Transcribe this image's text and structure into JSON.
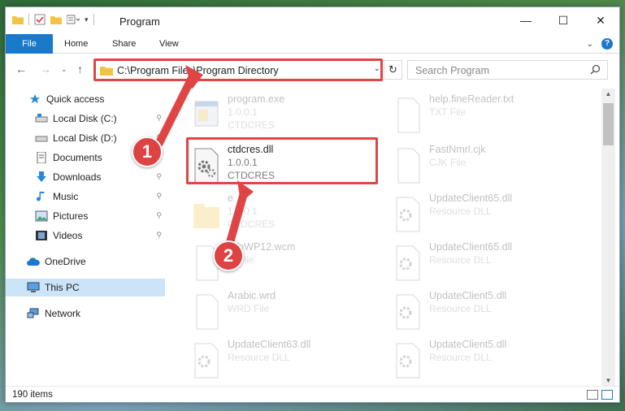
{
  "window": {
    "title": "Program"
  },
  "ribbon": {
    "tabs": [
      "File",
      "Home",
      "Share",
      "View"
    ]
  },
  "address": {
    "path": "C:\\Program Files\\Program Directory"
  },
  "search": {
    "placeholder": "Search Program"
  },
  "sidebar": {
    "items": [
      {
        "label": "Quick access",
        "icon": "star-icon"
      },
      {
        "label": "Local Disk (C:)",
        "icon": "drive-icon"
      },
      {
        "label": "Local Disk (D:)",
        "icon": "drive-icon"
      },
      {
        "label": "Documents",
        "icon": "documents-icon"
      },
      {
        "label": "Downloads",
        "icon": "download-icon"
      },
      {
        "label": "Music",
        "icon": "music-icon"
      },
      {
        "label": "Pictures",
        "icon": "pictures-icon"
      },
      {
        "label": "Videos",
        "icon": "video-icon"
      },
      {
        "label": "OneDrive",
        "icon": "cloud-icon"
      },
      {
        "label": "This PC",
        "icon": "computer-icon"
      },
      {
        "label": "Network",
        "icon": "network-icon"
      }
    ]
  },
  "files": [
    {
      "name": "program.exe",
      "line1": "1.0.0.1",
      "line2": "CTDCRES"
    },
    {
      "name": "help.fineReader.txt",
      "line1": "TXT File",
      "line2": ""
    },
    {
      "name": "ctdcres.dll",
      "line1": "1.0.0.1",
      "line2": "CTDCRES"
    },
    {
      "name": "FastNmrl.cjk",
      "line1": "CJK File",
      "line2": ""
    },
    {
      "name": "e",
      "line1": "1.0.0.1",
      "line2": "CTDCRES"
    },
    {
      "name": "UpdateClient65.dll",
      "line1": "Resource DLL",
      "line2": ""
    },
    {
      "name": "dToWP12.wcm",
      "line1": "M File",
      "line2": ""
    },
    {
      "name": "UpdateClient65.dll",
      "line1": "Resource DLL",
      "line2": ""
    },
    {
      "name": "Arabic.wrd",
      "line1": "WRD File",
      "line2": ""
    },
    {
      "name": "UpdateClient5.dll",
      "line1": "Resource DLL",
      "line2": ""
    },
    {
      "name": "UpdateClient63.dll",
      "line1": "Resource DLL",
      "line2": ""
    },
    {
      "name": "UpdateClient5.dll",
      "line1": "Resource DLL",
      "line2": ""
    }
  ],
  "status": {
    "count": "190 items"
  },
  "callouts": {
    "one": "1",
    "two": "2"
  },
  "colors": {
    "accent": "#1979ca",
    "highlight": "#e04545",
    "selected": "#cce4f7"
  }
}
